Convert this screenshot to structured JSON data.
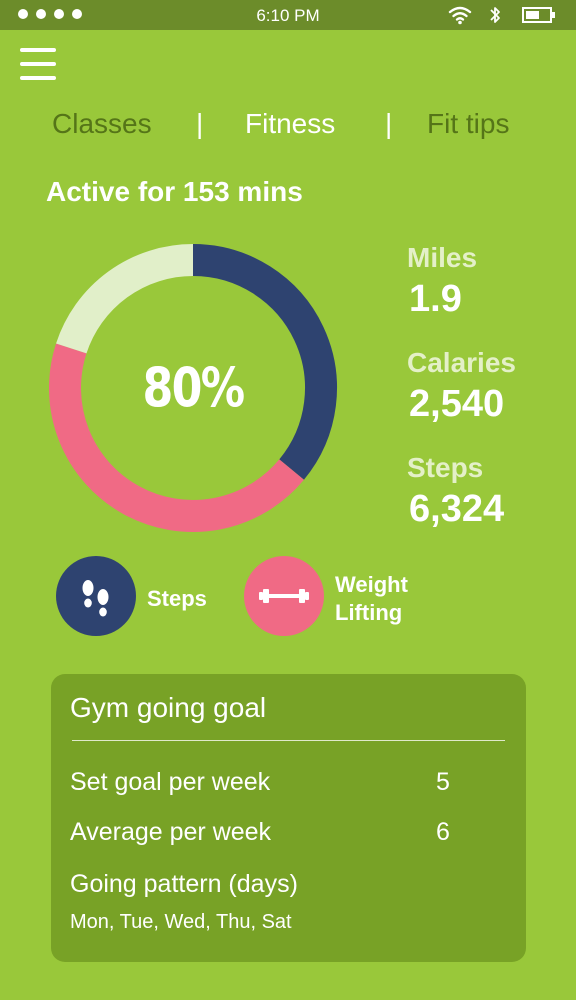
{
  "status_bar": {
    "time": "6:10 PM"
  },
  "tabs": [
    {
      "label": "Classes",
      "state": "inactive"
    },
    {
      "label": "Fitness",
      "state": "active"
    },
    {
      "label": "Fit tips",
      "state": "inactive"
    }
  ],
  "tab_separator": "|",
  "activity": {
    "title": "Active for 153 mins",
    "percent_label": "80%",
    "ring_segments": [
      {
        "name": "steps",
        "color": "#2e4370",
        "fraction": 0.36
      },
      {
        "name": "weight-lifting",
        "color": "#f06a85",
        "fraction": 0.44
      },
      {
        "name": "remaining",
        "color": "#e1efc9",
        "fraction": 0.2
      }
    ]
  },
  "stats": [
    {
      "label": "Miles",
      "value": "1.9"
    },
    {
      "label": "Calaries",
      "value": "2,540"
    },
    {
      "label": "Steps",
      "value": "6,324"
    }
  ],
  "legend": [
    {
      "label": "Steps",
      "icon": "footprints-icon",
      "color": "#2e4370"
    },
    {
      "label_line1": "Weight",
      "label_line2": "Lifting",
      "icon": "dumbbell-icon",
      "color": "#f06a85"
    }
  ],
  "goal_card": {
    "title": "Gym going goal",
    "set_goal_label": "Set goal per week",
    "set_goal_value": "5",
    "average_label": "Average per week",
    "average_value": "6",
    "pattern_label": "Going pattern (days)",
    "pattern_days": "Mon, Tue, Wed, Thu, Sat"
  },
  "colors": {
    "background": "#99c83a",
    "status_bar": "#6c8c2a",
    "card": "#78a226",
    "navy": "#2e4370",
    "pink": "#f06a85"
  }
}
